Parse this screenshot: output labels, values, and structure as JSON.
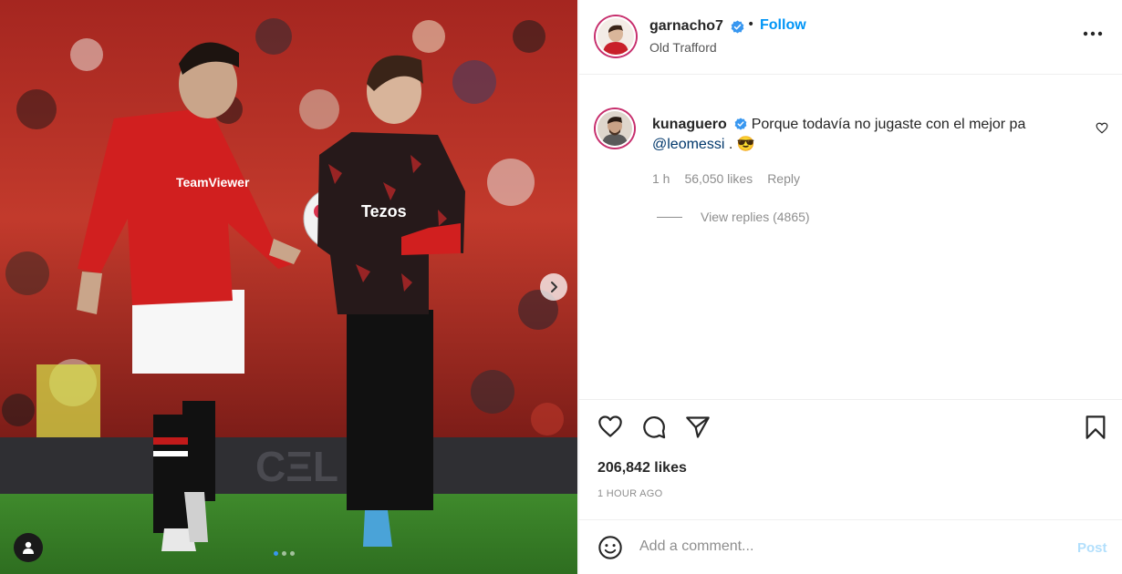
{
  "post": {
    "author": "garnacho7",
    "follow_label": "Follow",
    "separator": "•",
    "location": "Old Trafford",
    "likes": "206,842 likes",
    "time_ago": "1 HOUR AGO",
    "carousel": {
      "count": 3,
      "active_index": 0
    }
  },
  "photo": {
    "jersey_sponsor_text": "Tezos"
  },
  "comment": {
    "username": "kunaguero",
    "text": "Porque todavía no jugaste con el mejor pa",
    "mention": "@leomessi",
    "suffix": ".",
    "emoji": "😎",
    "time": "1 h",
    "likes": "56,050 likes",
    "reply_label": "Reply",
    "view_replies": "View replies (4865)"
  },
  "composer": {
    "placeholder": "Add a comment...",
    "post_label": "Post"
  },
  "colors": {
    "follow_blue": "#0095f6",
    "verified_blue": "#3897f0",
    "story_ring": "#c72f6d",
    "post_disabled": "#b2dffc",
    "text_secondary": "#8e8e8e"
  },
  "icons": [
    "verified-icon",
    "more-options-icon",
    "heart-icon",
    "comment-icon",
    "share-icon",
    "bookmark-icon",
    "emoji-icon",
    "chevron-right-icon",
    "user-tag-icon"
  ]
}
